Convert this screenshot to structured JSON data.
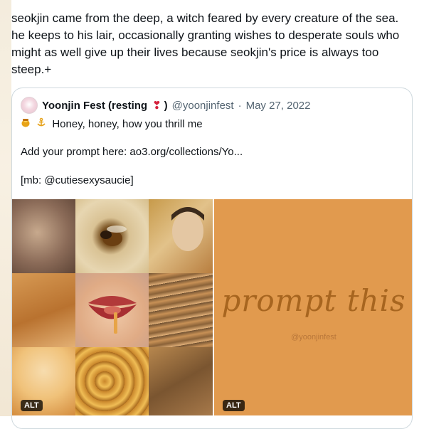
{
  "tweet": {
    "text": "seokjin came from the deep, a witch feared by every creature of the sea. he keeps to his lair, occasionally granting wishes to desperate souls who might as well give up their lives because seokjin's price is always too steep.+"
  },
  "quote": {
    "author_name": "Yoonjin Fest (resting",
    "author_name_suffix": ")",
    "handle": "@yoonjinfest",
    "separator": "·",
    "date": "May 27, 2022",
    "line1": "Honey, honey, how you thrill me",
    "line2": "Add your prompt here: ao3.org/collections/Yo...",
    "line3": "[mb: @cutiesexysaucie]",
    "icons": [
      "avatar",
      "heart-exclamation-icon",
      "honey-pot-icon",
      "anchor-icon"
    ]
  },
  "media": {
    "promo_title": "prompt this",
    "promo_handle": "@yoonjinfest",
    "alt_label": "ALT",
    "promo_bg": "#e19a4e"
  }
}
